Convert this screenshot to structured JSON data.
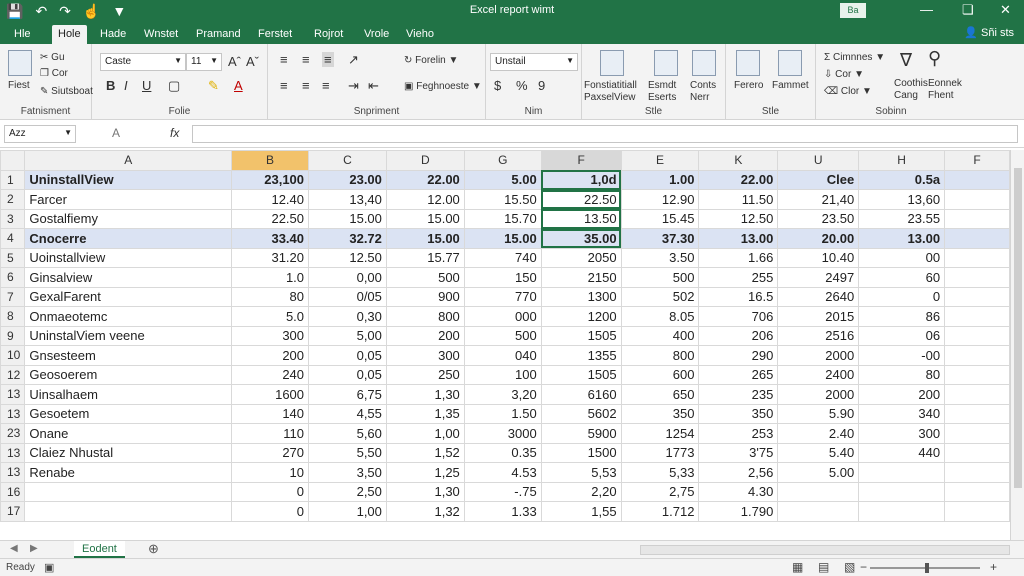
{
  "titlebar": {
    "title": "Excel report wimt",
    "qa_icons": [
      "save-icon",
      "undo-icon",
      "redo-icon",
      "touch-icon",
      "customize-icon"
    ],
    "signin": "Ba",
    "window_controls": [
      "minimize-icon",
      "restore-icon",
      "close-icon"
    ]
  },
  "tabs": [
    "Hle",
    "Hole",
    "Hade",
    "Wnstet",
    "Pramand",
    "Ferstet",
    "Rojrot",
    "Vrole",
    "Vieho"
  ],
  "active_tab": 1,
  "share": "Sñi sts",
  "ribbon": {
    "clipboard": {
      "label": "Fatnisment",
      "paste": "Fiest",
      "cut": "Gu",
      "copy": "Cor",
      "format": "Siutsboat"
    },
    "font": {
      "label": "Folie",
      "font_name": "Caste",
      "font_size": "11",
      "bold": "B",
      "italic": "I",
      "underline": "U"
    },
    "alignment": {
      "label": "Snpriment",
      "wrap": "Forelin",
      "merge": "Feghnoeste"
    },
    "number": {
      "label": "Nim",
      "format": "Unstail",
      "currency": "$",
      "percent": "%",
      "comma": "9"
    },
    "styles": {
      "label": "Stle",
      "cond": [
        "Fonstiatitiall",
        "PaxselView"
      ],
      "table": [
        "Esmdt",
        "Eserts"
      ],
      "cell": [
        "Conts",
        "Nerr"
      ]
    },
    "cells": {
      "label": "Stle",
      "items": [
        "Ferero",
        "Fammet"
      ]
    },
    "editing": {
      "label": "Sobinn",
      "autosum": "Cimnnes",
      "fill": "Cor",
      "clear": "Clor",
      "sort": "Coothis",
      "sort_sub": "Cang",
      "find": "Eonnek",
      "find_sub": "Fhent"
    }
  },
  "formula_bar": {
    "name_box": "Azz",
    "fx": "fx",
    "cancel": "X",
    "enter": "A",
    "content": ""
  },
  "columns": [
    "A",
    "B",
    "C",
    "D",
    "G",
    "F",
    "E",
    "K",
    "U",
    "H",
    "F"
  ],
  "rows": [
    {
      "n": "1",
      "cells": [
        "UninstallView",
        "23,100",
        "23.00",
        "22.00",
        "5.00",
        "1,0d",
        "1.00",
        "22.00",
        "Clee",
        "0.5a",
        ""
      ],
      "band": true
    },
    {
      "n": "2",
      "cells": [
        "Farcer",
        "12.40",
        "13,40",
        "12.00",
        "15.50",
        "22.50",
        "12.90",
        "11.50",
        "21,40",
        "13,60",
        ""
      ]
    },
    {
      "n": "3",
      "cells": [
        "Gostalfiemy",
        "22.50",
        "15.00",
        "15.00",
        "15.70",
        "13.50",
        "15.45",
        "12.50",
        "23.50",
        "23.55",
        ""
      ]
    },
    {
      "n": "4",
      "cells": [
        "Cnocerre",
        "33.40",
        "32.72",
        "15.00",
        "15.00",
        "35.00",
        "37.30",
        "13.00",
        "20.00",
        "13.00",
        ""
      ],
      "band": true
    },
    {
      "n": "5",
      "cells": [
        "Uoinstallview",
        "31.20",
        "12.50",
        "15.77",
        "740",
        "2050",
        "3.50",
        "1.66",
        "10.40",
        "00",
        ""
      ]
    },
    {
      "n": "6",
      "cells": [
        "Ginsalview",
        "1.0",
        "0,00",
        "500",
        "150",
        "2150",
        "500",
        "255",
        "2497",
        "60",
        ""
      ]
    },
    {
      "n": "7",
      "cells": [
        "GexalFarent",
        "80",
        "0/05",
        "900",
        "770",
        "1300",
        "502",
        "16.5",
        "2640",
        "0",
        ""
      ]
    },
    {
      "n": "8",
      "cells": [
        "Onmaeotemc",
        "5.0",
        "0,30",
        "800",
        "000",
        "1200",
        "8.05",
        "706",
        "2015",
        "86",
        ""
      ]
    },
    {
      "n": "9",
      "cells": [
        "UninstalViem veene",
        "300",
        "5,00",
        "200",
        "500",
        "1505",
        "400",
        "206",
        "2516",
        "06",
        ""
      ]
    },
    {
      "n": "10",
      "cells": [
        "Gnsesteem",
        "200",
        "0,05",
        "300",
        "040",
        "1355",
        "800",
        "290",
        "2000",
        "-00",
        ""
      ]
    },
    {
      "n": "12",
      "cells": [
        "Geosoerem",
        "240",
        "0,05",
        "250",
        "100",
        "1505",
        "600",
        "265",
        "2400",
        "80",
        ""
      ]
    },
    {
      "n": "13",
      "cells": [
        "Uinsalhaem",
        "1600",
        "6,75",
        "1,30",
        "3,20",
        "6160",
        "650",
        "235",
        "2000",
        "200",
        ""
      ]
    },
    {
      "n": "13",
      "cells": [
        "Gesoetem",
        "140",
        "4,55",
        "1,35",
        "1.50",
        "5602",
        "350",
        "350",
        "5.90",
        "340",
        ""
      ]
    },
    {
      "n": "23",
      "cells": [
        "Onane",
        "110",
        "5,60",
        "1,00",
        "3000",
        "5900",
        "1254",
        "253",
        "2.40",
        "300",
        ""
      ]
    },
    {
      "n": "13",
      "cells": [
        "Claiez Nhustal",
        "270",
        "5,50",
        "1,52",
        "0.35",
        "1500",
        "1773",
        "3'75",
        "5.40",
        "440",
        ""
      ]
    },
    {
      "n": "13",
      "cells": [
        "Renabe",
        "10",
        "3,50",
        "1,25",
        "4.53",
        "5,53",
        "5,33",
        "2,56",
        "5.00",
        "",
        ""
      ]
    },
    {
      "n": "16",
      "cells": [
        "",
        "0",
        "2,50",
        "1,30",
        "-.75",
        "2,20",
        "2,75",
        "4.30",
        "",
        "",
        ""
      ]
    },
    {
      "n": "17",
      "cells": [
        "",
        "0",
        "1,00",
        "1,32",
        "1.33",
        "1,55",
        "1.712",
        "1.790",
        "",
        "",
        ""
      ]
    }
  ],
  "sheet_tabs": [
    "Eodent"
  ],
  "add_sheet": "⊕",
  "status": {
    "ready": "Ready",
    "views": [
      "normal-view-icon",
      "page-layout-icon",
      "page-break-icon"
    ],
    "zoom_minus": "−",
    "zoom_plus": "+"
  }
}
